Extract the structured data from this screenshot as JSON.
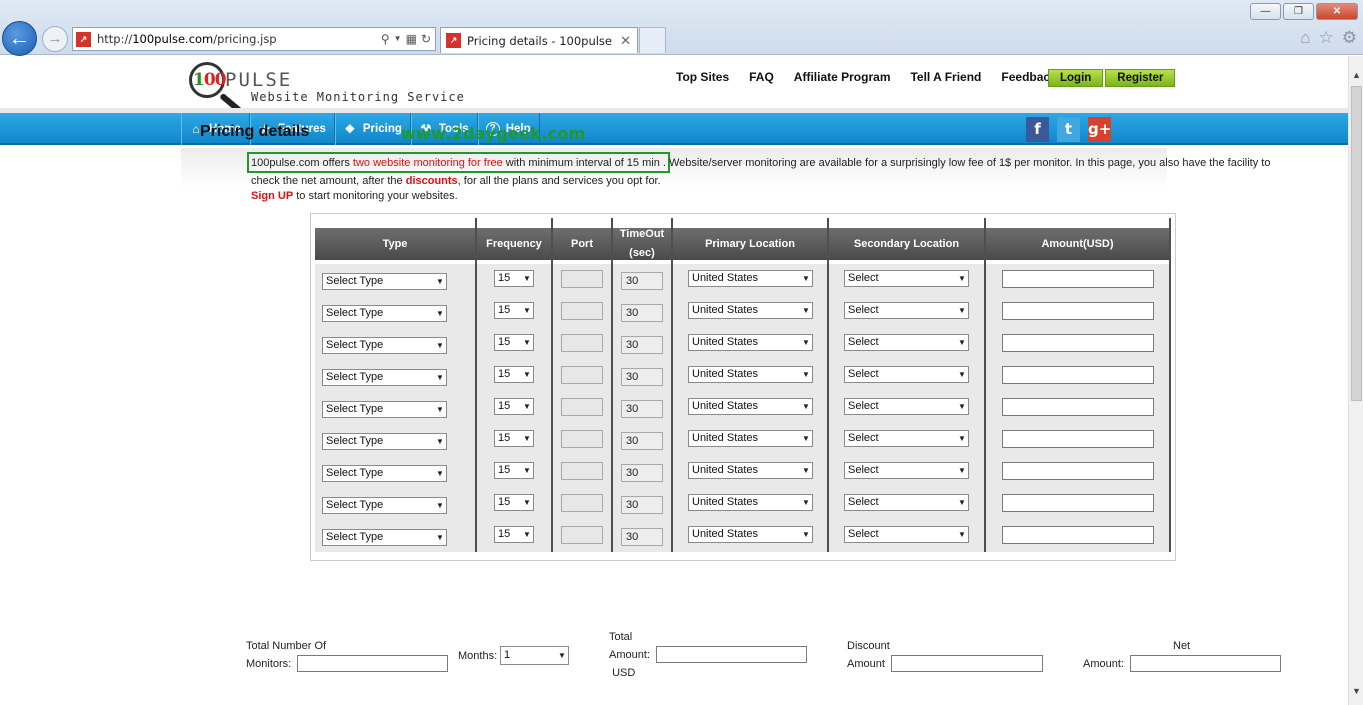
{
  "browser": {
    "url_prefix": "http://",
    "url_host": "100pulse.com",
    "url_path": "/pricing.jsp",
    "tab_title": "Pricing details - 100pulse"
  },
  "header": {
    "logo_digits": [
      "1",
      "0",
      "0"
    ],
    "logo_word": "PULSE",
    "logo_tagline": "Website Monitoring Service",
    "top_links": [
      "Top Sites",
      "FAQ",
      "Affiliate Program",
      "Tell A Friend",
      "Feedback"
    ],
    "login_label": "Login",
    "register_label": "Register"
  },
  "nav": {
    "items": [
      {
        "label": "Home",
        "icon": "home-icon"
      },
      {
        "label": "Features",
        "icon": "star-icon"
      },
      {
        "label": "Pricing",
        "icon": "tag-icon"
      },
      {
        "label": "Tools",
        "icon": "wrench-icon"
      },
      {
        "label": "Help",
        "icon": "help-icon"
      }
    ],
    "social": [
      "f",
      "t",
      "g+"
    ]
  },
  "page": {
    "title": "Pricing details",
    "watermark": "www.2daygeek.com",
    "intro_a": "100pulse.com offers ",
    "intro_red": "two website monitoring for free",
    "intro_b": " with minimum interval of 15 min . Website/server monitoring are available for a surprisingly low fee of 1$ per monitor. In this page, you also have the facility to check the net amount, after the ",
    "intro_discounts": "discounts",
    "intro_c": ", for all the plans and services you opt for.",
    "signup_link": "Sign UP",
    "signup_rest": " to start monitoring your websites."
  },
  "table": {
    "headers": {
      "type": "Type",
      "frequency": "Frequency",
      "port": "Port",
      "timeout": "TimeOut (sec)",
      "primary": "Primary Location",
      "secondary": "Secondary Location",
      "amount": "Amount(USD)"
    },
    "rows": [
      {
        "type": "Select Type",
        "frequency": "15",
        "timeout": "30",
        "primary": "United States",
        "secondary": "Select"
      },
      {
        "type": "Select Type",
        "frequency": "15",
        "timeout": "30",
        "primary": "United States",
        "secondary": "Select"
      },
      {
        "type": "Select Type",
        "frequency": "15",
        "timeout": "30",
        "primary": "United States",
        "secondary": "Select"
      },
      {
        "type": "Select Type",
        "frequency": "15",
        "timeout": "30",
        "primary": "United States",
        "secondary": "Select"
      },
      {
        "type": "Select Type",
        "frequency": "15",
        "timeout": "30",
        "primary": "United States",
        "secondary": "Select"
      },
      {
        "type": "Select Type",
        "frequency": "15",
        "timeout": "30",
        "primary": "United States",
        "secondary": "Select"
      },
      {
        "type": "Select Type",
        "frequency": "15",
        "timeout": "30",
        "primary": "United States",
        "secondary": "Select"
      },
      {
        "type": "Select Type",
        "frequency": "15",
        "timeout": "30",
        "primary": "United States",
        "secondary": "Select"
      },
      {
        "type": "Select Type",
        "frequency": "15",
        "timeout": "30",
        "primary": "United States",
        "secondary": "Select"
      }
    ]
  },
  "summary": {
    "total_monitors_l1": "Total Number Of",
    "total_monitors_l2": "Monitors:",
    "months_label": "Months:",
    "months_value": "1",
    "total_l1": "Total",
    "total_l2": "Amount:",
    "total_l3": "USD",
    "discount_l1": "Discount",
    "discount_l2": "Amount",
    "net_l1": "Net",
    "net_l2": "Amount:"
  }
}
